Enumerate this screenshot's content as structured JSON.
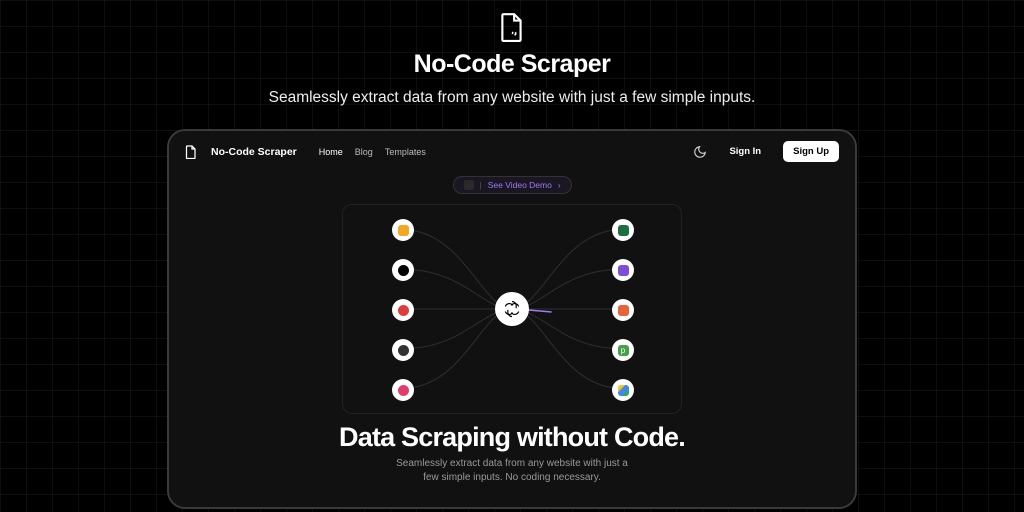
{
  "top": {
    "title": "No-Code Scraper",
    "subtitle": "Seamlessly extract data from any website with just a few simple inputs."
  },
  "nav": {
    "brand": "No-Code Scraper",
    "links": [
      "Home",
      "Blog",
      "Templates"
    ],
    "signin": "Sign In",
    "signup": "Sign Up"
  },
  "demo_pill": {
    "text": "See Video Demo",
    "sep": "|",
    "chev": "›"
  },
  "hero": {
    "title": "Data Scraping without Code.",
    "subtitle_l1": "Seamlessly extract data from any website with just a",
    "subtitle_l2": "few simple inputs. No coding necessary."
  },
  "nodes": {
    "left": [
      {
        "color": "#f5a623",
        "name": "etsy"
      },
      {
        "color": "#000000",
        "name": "medium"
      },
      {
        "color": "#e03c3c",
        "name": "producthunt"
      },
      {
        "color": "#333333",
        "name": "wordpress"
      },
      {
        "color": "#7f2fe0",
        "name": "knack"
      }
    ],
    "right": [
      {
        "color": "#1d6f42",
        "name": "excel"
      },
      {
        "color": "#7e4ed8",
        "name": "notion"
      },
      {
        "color": "#e8623a",
        "name": "sheets"
      },
      {
        "color": "#43a047",
        "name": "parabola"
      },
      {
        "color": "#f5c518",
        "name": "drive"
      }
    ],
    "center": "openai"
  }
}
